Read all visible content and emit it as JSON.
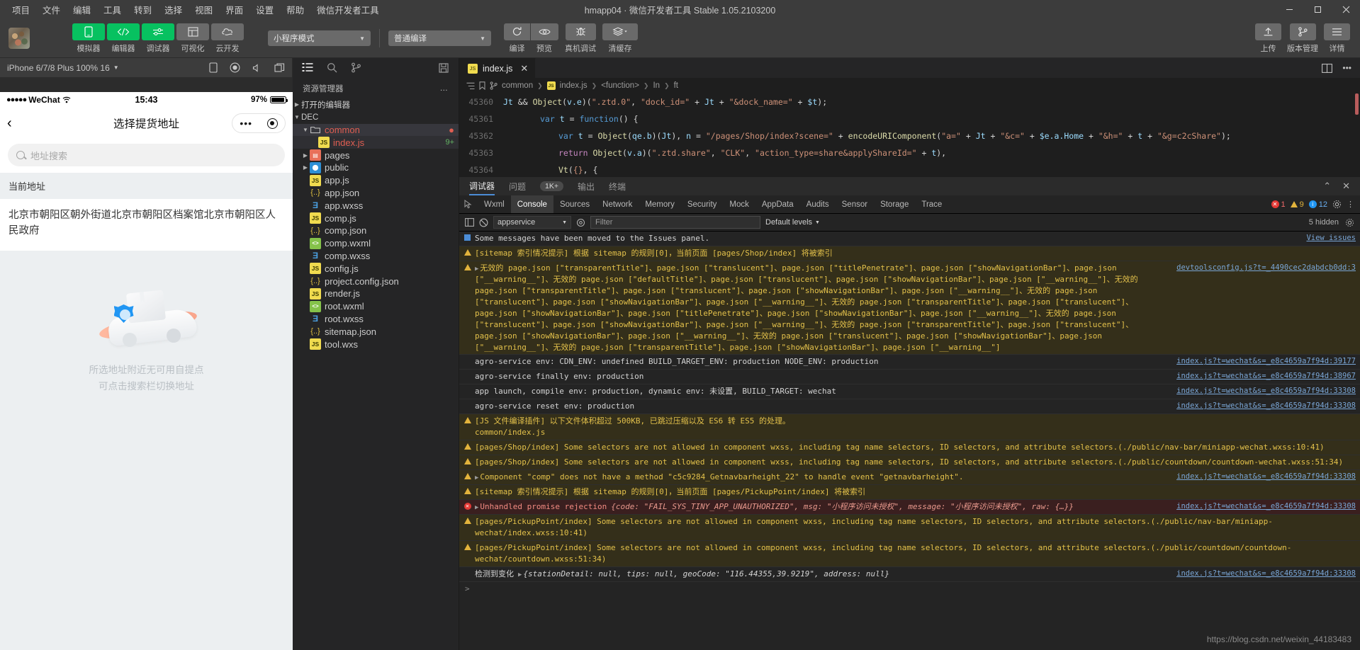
{
  "window": {
    "title": "hmapp04 · 微信开发者工具 Stable 1.05.2103200",
    "menus": [
      "项目",
      "文件",
      "编辑",
      "工具",
      "转到",
      "选择",
      "视图",
      "界面",
      "设置",
      "帮助",
      "微信开发者工具"
    ],
    "controls": {
      "minimize": "—",
      "maximize": "▢",
      "close": "✕"
    }
  },
  "toolbar": {
    "modes": [
      {
        "label": "模拟器",
        "icon": "phone-icon",
        "active": true
      },
      {
        "label": "编辑器",
        "icon": "code-icon",
        "active": true
      },
      {
        "label": "调试器",
        "icon": "sliders-icon",
        "active": true
      },
      {
        "label": "可视化",
        "icon": "layout-icon",
        "active": false
      },
      {
        "label": "云开发",
        "icon": "cloud-icon",
        "active": false
      }
    ],
    "mode_select": "小程序模式",
    "compile_select": "普通编译",
    "actions": [
      {
        "label": "编译",
        "icon": "refresh-icon"
      },
      {
        "label": "预览",
        "icon": "eye-icon"
      },
      {
        "label": "真机调试",
        "icon": "bug-icon"
      },
      {
        "label": "清缓存",
        "icon": "layers-icon"
      }
    ],
    "right_actions": [
      {
        "label": "上传",
        "icon": "upload-icon"
      },
      {
        "label": "版本管理",
        "icon": "branch-icon"
      },
      {
        "label": "详情",
        "icon": "menu-icon"
      }
    ]
  },
  "simulator": {
    "device": "iPhone 6/7/8 Plus 100% 16",
    "header_icons": [
      "device-rotate-icon",
      "record-icon",
      "volume-icon",
      "multiscreen-icon"
    ],
    "status_bar": {
      "carrier": "WeChat",
      "signal_dots": "●●●●●",
      "time": "15:43",
      "battery": "97%"
    },
    "nav": {
      "back": "‹",
      "title": "选择提货地址"
    },
    "search_placeholder": "地址搜索",
    "section_label": "当前地址",
    "address": "北京市朝阳区朝外街道北京市朝阳区档案馆北京市朝阳区人民政府",
    "empty_line1": "所选地址附近无可用自提点",
    "empty_line2": "可点击搜索栏切换地址"
  },
  "explorer": {
    "icons": [
      "files-icon",
      "search-icon",
      "source-control-icon",
      "save-all-icon"
    ],
    "title": "资源管理器",
    "more": "…",
    "sections": [
      {
        "label": "打开的编辑器",
        "expanded": false
      },
      {
        "label": "DEC",
        "expanded": true
      }
    ],
    "tree": [
      {
        "name": "common",
        "type": "folder",
        "indent": 1,
        "expanded": true,
        "selected": true,
        "modified": true
      },
      {
        "name": "index.js",
        "type": "js",
        "indent": 2,
        "selected": true,
        "badge": "9+"
      },
      {
        "name": "pages",
        "type": "folder-pages",
        "indent": 1,
        "expanded": false
      },
      {
        "name": "public",
        "type": "folder-public",
        "indent": 1,
        "expanded": false
      },
      {
        "name": "app.js",
        "type": "js",
        "indent": 1
      },
      {
        "name": "app.json",
        "type": "json",
        "indent": 1
      },
      {
        "name": "app.wxss",
        "type": "wxss",
        "indent": 1
      },
      {
        "name": "comp.js",
        "type": "js",
        "indent": 1
      },
      {
        "name": "comp.json",
        "type": "json",
        "indent": 1
      },
      {
        "name": "comp.wxml",
        "type": "wxml",
        "indent": 1
      },
      {
        "name": "comp.wxss",
        "type": "wxss",
        "indent": 1
      },
      {
        "name": "config.js",
        "type": "js",
        "indent": 1
      },
      {
        "name": "project.config.json",
        "type": "json",
        "indent": 1
      },
      {
        "name": "render.js",
        "type": "js",
        "indent": 1
      },
      {
        "name": "root.wxml",
        "type": "wxml",
        "indent": 1
      },
      {
        "name": "root.wxss",
        "type": "wxss",
        "indent": 1
      },
      {
        "name": "sitemap.json",
        "type": "json",
        "indent": 1
      },
      {
        "name": "tool.wxs",
        "type": "wxs",
        "indent": 1
      }
    ]
  },
  "editor": {
    "tab": {
      "name": "index.js",
      "close": "✕"
    },
    "tab_right_icons": [
      "split-editor-icon",
      "more-actions-icon"
    ],
    "breadcrumb": [
      "common",
      "index.js",
      "<function>",
      "In",
      "ft"
    ],
    "breadcrumb_icons": [
      "outline-icon",
      "bookmark-icon",
      "branch-icon"
    ],
    "lines": [
      {
        "num": "45360",
        "text": "Jt && Object(v.e)(\".ztd.0\", \"dock_id=\" + Jt + \"&dock_name=\" + $t);"
      },
      {
        "num": "45361",
        "text": "var t = function() {"
      },
      {
        "num": "45362",
        "text": "var t = Object(qe.b)(Jt), n = \"/pages/Shop/index?scene=\" + encodeURIComponent(\"a=\" + Jt + \"&c=\" + $e.a.Home + \"&h=\" + t + \"&g=c2cShare\");"
      },
      {
        "num": "45363",
        "text": "return Object(v.a)(\".ztd.share\", \"CLK\", \"action_type=share&applyShareId=\" + t),"
      },
      {
        "num": "45364",
        "text": "Vt({}, {"
      }
    ]
  },
  "panel": {
    "tabs": [
      {
        "label": "调试器",
        "active": true
      },
      {
        "label": "问题",
        "active": false
      },
      {
        "label": "1K+",
        "pill": true
      },
      {
        "label": "输出",
        "active": false
      },
      {
        "label": "终端",
        "active": false
      }
    ],
    "right_icons": [
      "chevron-up-icon",
      "close-icon"
    ]
  },
  "devtools": {
    "tabs": [
      "Wxml",
      "Console",
      "Sources",
      "Network",
      "Memory",
      "Security",
      "Mock",
      "AppData",
      "Audits",
      "Sensor",
      "Storage",
      "Trace"
    ],
    "active_tab": "Console",
    "counts": {
      "errors": "1",
      "warnings": "9",
      "info": "12"
    },
    "right_icons": [
      "settings-icon",
      "more-icon"
    ],
    "filter": {
      "context": "appservice",
      "placeholder": "Filter",
      "levels": "Default levels",
      "hidden": "5 hidden"
    },
    "messages": [
      {
        "level": "info",
        "text": "Some messages have been moved to the Issues panel.",
        "action": "View issues"
      },
      {
        "level": "warn",
        "text": "[sitemap 索引情况提示] 根据 sitemap 的规则[0]，当前页面 [pages/Shop/index] 将被索引"
      },
      {
        "level": "warn",
        "expandable": true,
        "text": "无效的 page.json [\"transparentTitle\"]、page.json [\"translucent\"]、page.json [\"titlePenetrate\"]、page.json [\"showNavigationBar\"]、page.json [\"__warning__\"]、无效的 page.json [\"defaultTitle\"]、page.json [\"translucent\"]、page.json [\"showNavigationBar\"]、page.json [\"__warning__\"]、无效的 page.json [\"transparentTitle\"]、page.json [\"translucent\"]、page.json [\"showNavigationBar\"]、page.json [\"__warning__\"]、无效的 page.json [\"translucent\"]、page.json [\"showNavigationBar\"]、page.json [\"__warning__\"]、无效的 page.json [\"transparentTitle\"]、page.json [\"translucent\"]、page.json [\"showNavigationBar\"]、page.json [\"titlePenetrate\"]、page.json [\"showNavigationBar\"]、page.json [\"__warning__\"]、无效的 page.json [\"translucent\"]、page.json [\"showNavigationBar\"]、page.json [\"__warning__\"]、无效的 page.json [\"transparentTitle\"]、page.json [\"translucent\"]、page.json [\"showNavigationBar\"]、page.json [\"__warning__\"]、无效的 page.json [\"translucent\"]、page.json [\"showNavigationBar\"]、page.json [\"__warning__\"]、无效的 page.json [\"transparentTitle\"]、page.json [\"showNavigationBar\"]、page.json [\"__warning__\"]",
        "source": "devtoolsconfig.js?t=_4490cec2dabdcb0dd:3"
      },
      {
        "level": "log",
        "text": "agro-service env: CDN_ENV:  undefined  BUILD_TARGET_ENV:  production  NODE_ENV:  production",
        "source": "index.js?t=wechat&s=_e8c4659a7f94d:39177"
      },
      {
        "level": "log",
        "text": "agro-service finally env:  production",
        "source": "index.js?t=wechat&s=_e8c4659a7f94d:38967"
      },
      {
        "level": "log",
        "text": "app launch, compile env: production, dynamic env: 未设置, BUILD_TARGET: wechat",
        "source": "index.js?t=wechat&s=_e8c4659a7f94d:33308"
      },
      {
        "level": "log",
        "text": "agro-service reset env:  production",
        "source": "index.js?t=wechat&s=_e8c4659a7f94d:33308"
      },
      {
        "level": "warn",
        "text": "[JS 文件编译插件] 以下文件体积超过 500KB, 已跳过压缩以及 ES6 转 ES5 的处理。\ncommon/index.js"
      },
      {
        "level": "warn",
        "text": "[pages/Shop/index] Some selectors are not allowed in component wxss, including tag name selectors, ID selectors, and attribute selectors.(./public/nav-bar/miniapp-wechat.wxss:10:41)"
      },
      {
        "level": "warn",
        "text": "[pages/Shop/index] Some selectors are not allowed in component wxss, including tag name selectors, ID selectors, and attribute selectors.(./public/countdown/countdown-wechat.wxss:51:34)"
      },
      {
        "level": "warn",
        "expandable": true,
        "text": "Component \"comp\" does not have a method \"c5c9284_Getnavbarheight_22\" to handle event \"getnavbarheight\".",
        "source": "index.js?t=wechat&s=_e8c4659a7f94d:33308"
      },
      {
        "level": "warn",
        "text": "[sitemap 索引情况提示] 根据 sitemap 的规则[0]，当前页面 [pages/PickupPoint/index] 将被索引"
      },
      {
        "level": "err",
        "expandable": true,
        "text": "Unhandled promise rejection",
        "detail": "{code: \"FAIL_SYS_TINY_APP_UNAUTHORIZED\", msg: \"小程序访问未授权\", message: \"小程序访问未授权\", raw: {…}}",
        "source": "index.js?t=wechat&s=_e8c4659a7f94d:33308"
      },
      {
        "level": "warn",
        "text": "[pages/PickupPoint/index] Some selectors are not allowed in component wxss, including tag name selectors, ID selectors, and attribute selectors.(./public/nav-bar/miniapp-wechat/index.wxss:10:41)"
      },
      {
        "level": "warn",
        "text": "[pages/PickupPoint/index] Some selectors are not allowed in component wxss, including tag name selectors, ID selectors, and attribute selectors.(./public/countdown/countdown-wechat/countdown.wxss:51:34)"
      },
      {
        "level": "log",
        "expandable": true,
        "text": "检测到变化",
        "detail": "{stationDetail: null, tips: null, geoCode: \"116.44355,39.9219\", address: null}",
        "source": "index.js?t=wechat&s=_e8c4659a7f94d:33308"
      }
    ],
    "prompt": ">"
  },
  "watermark": "https://blog.csdn.net/weixin_44183483"
}
